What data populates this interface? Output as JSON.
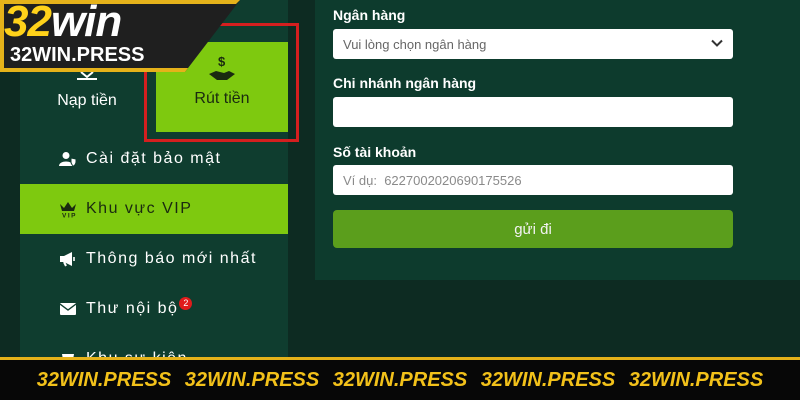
{
  "logo": {
    "brand_number": "32",
    "brand_word": "win",
    "domain": "32WIN.PRESS"
  },
  "tabs": {
    "deposit": "Nạp tiền",
    "withdraw": "Rút tiền"
  },
  "menu": [
    {
      "label": "Cài đặt bảo mật",
      "icon": "user-shield-icon"
    },
    {
      "label": "Khu vực VIP",
      "icon": "vip-crown-icon"
    },
    {
      "label": "Thông báo mới nhất",
      "icon": "megaphone-icon"
    },
    {
      "label": "Thư nội bộ",
      "icon": "envelope-icon",
      "badge": "2"
    },
    {
      "label": "Khu sự kiện",
      "icon": "event-icon"
    }
  ],
  "form": {
    "bank_label": "Ngân hàng",
    "bank_select_value": "Vui lòng chọn ngân hàng",
    "branch_label": "Chi nhánh ngân hàng",
    "branch_value": "",
    "account_label": "Số tài khoản",
    "account_placeholder": "Ví dụ:  6227002020690175526",
    "submit_label": "gửi đi"
  },
  "banner": [
    "32WIN.PRESS",
    "32WIN.PRESS",
    "32WIN.PRESS",
    "32WIN.PRESS",
    "32WIN.PRESS"
  ],
  "colors": {
    "accent_green": "#7ec90f",
    "submit_green": "#5b9e1c",
    "highlight_red": "#d41f1f",
    "banner_gold": "#f2c11a"
  }
}
